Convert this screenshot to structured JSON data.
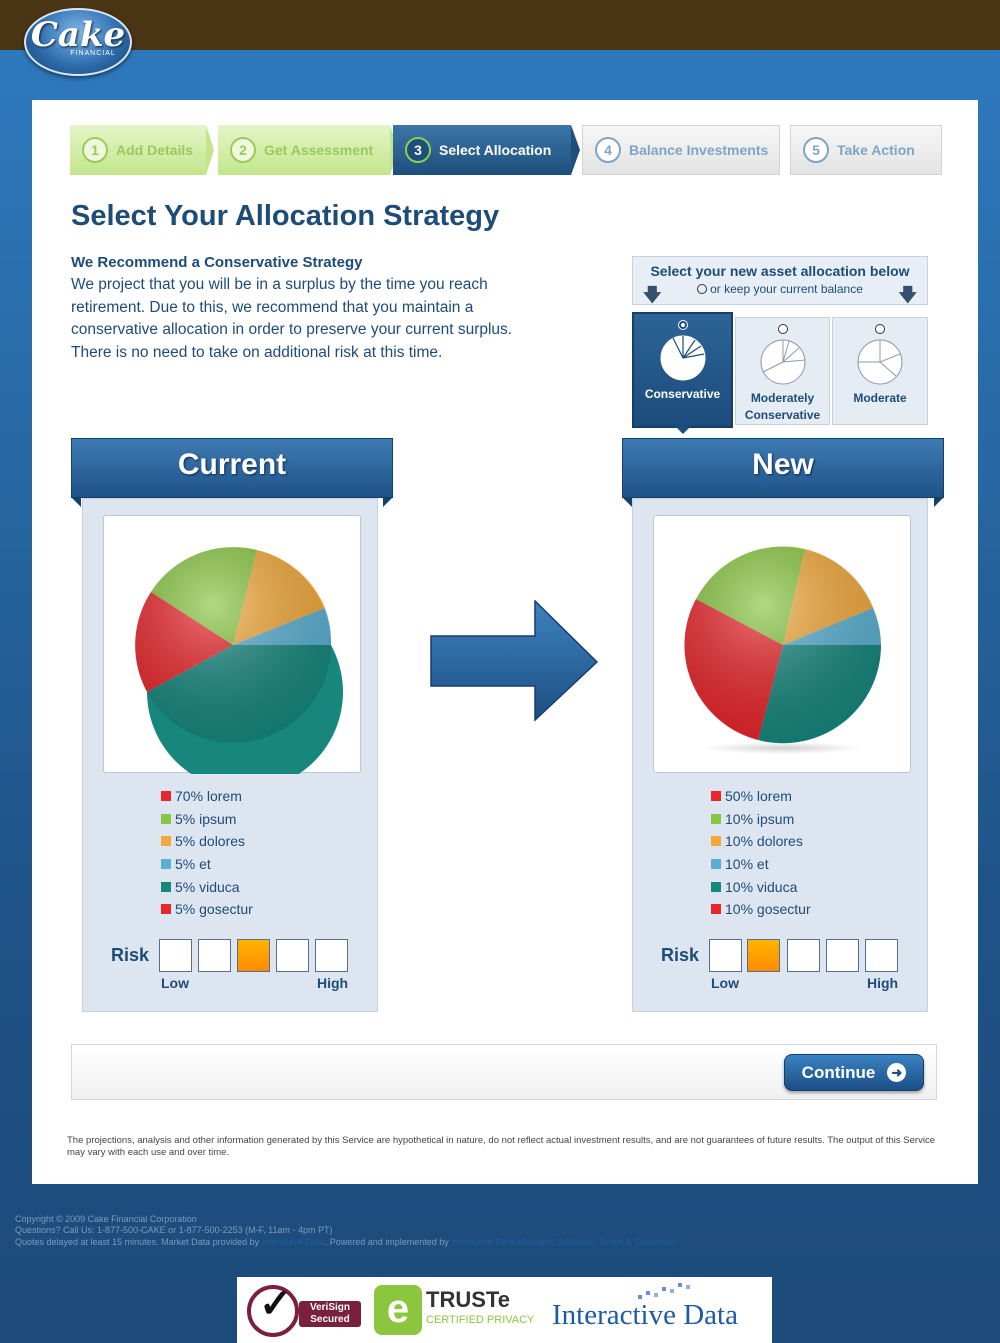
{
  "brand": {
    "name": "Cake",
    "tagline": "FINANCIAL"
  },
  "steps": [
    {
      "num": "1",
      "label": "Add Details",
      "state": "done"
    },
    {
      "num": "2",
      "label": "Get Assessment",
      "state": "done"
    },
    {
      "num": "3",
      "label": "Select Allocation",
      "state": "active"
    },
    {
      "num": "4",
      "label": "Balance Investments",
      "state": "todo"
    },
    {
      "num": "5",
      "label": "Take Action",
      "state": "todo"
    }
  ],
  "page_title": "Select Your Allocation Strategy",
  "recommendation": {
    "title": "We Recommend a Conservative Strategy",
    "body": "We project that you will be in a surplus by the time you reach retirement. Due to this, we recommend that you maintain a conservative allocation in order to preserve your current surplus. There is no need to take on additional risk at this time."
  },
  "selector": {
    "heading": "Select your new asset allocation below",
    "keep_option": "or keep your current balance",
    "options": [
      {
        "label": "Conservative",
        "selected": true
      },
      {
        "label": "Moderately Conservative",
        "selected": false
      },
      {
        "label": "Moderate",
        "selected": false
      }
    ]
  },
  "current": {
    "title": "Current",
    "legend": [
      {
        "text": "70% lorem",
        "color": "#e8262b"
      },
      {
        "text": "5% ipsum",
        "color": "#88c540"
      },
      {
        "text": "5% dolores",
        "color": "#f2a93b"
      },
      {
        "text": "5% et",
        "color": "#5bb0d2"
      },
      {
        "text": "5% viduca",
        "color": "#17877e"
      },
      {
        "text": "5% gosectur",
        "color": "#e8262b"
      }
    ],
    "risk": {
      "label": "Risk",
      "level": 3,
      "of": 5,
      "low": "Low",
      "high": "High"
    }
  },
  "new": {
    "title": "New",
    "legend": [
      {
        "text": "50% lorem",
        "color": "#e8262b"
      },
      {
        "text": "10% ipsum",
        "color": "#88c540"
      },
      {
        "text": "10% dolores",
        "color": "#f2a93b"
      },
      {
        "text": "10% et",
        "color": "#5bb0d2"
      },
      {
        "text": "10% viduca",
        "color": "#17877e"
      },
      {
        "text": "10% gosectur",
        "color": "#e8262b"
      }
    ],
    "risk": {
      "label": "Risk",
      "level": 2,
      "of": 5,
      "low": "Low",
      "high": "High"
    }
  },
  "continue_label": "Continue",
  "disclaimer": "The projections, analysis and other information generated by this Service are hypothetical in nature, do not reflect actual investment results, and are not guarantees of future results. The output of this Service may vary with each use and over time.",
  "footer": {
    "copyright": "Copyright © 2009 Cake Financial Corporation",
    "questions": "Questions? Call Us: 1-877-500-CAKE or 1-877-500-2253 (M-F, 11am - 4pm PT)",
    "quotes_prefix": "Quotes delayed at least 15 minutes. Market Data provided by",
    "quotes_link": "Interactive Data",
    "powered_prefix": ". Powered and implemented by",
    "powered_link": "Interactive Data Managed Solutions.",
    "terms_link": "Terms & Conditions"
  },
  "badges": {
    "verisign": "VeriSign Secured",
    "truste": "TRUSTe",
    "truste_sub": "CERTIFIED PRIVACY",
    "interactive_data": "Interactive Data"
  }
}
